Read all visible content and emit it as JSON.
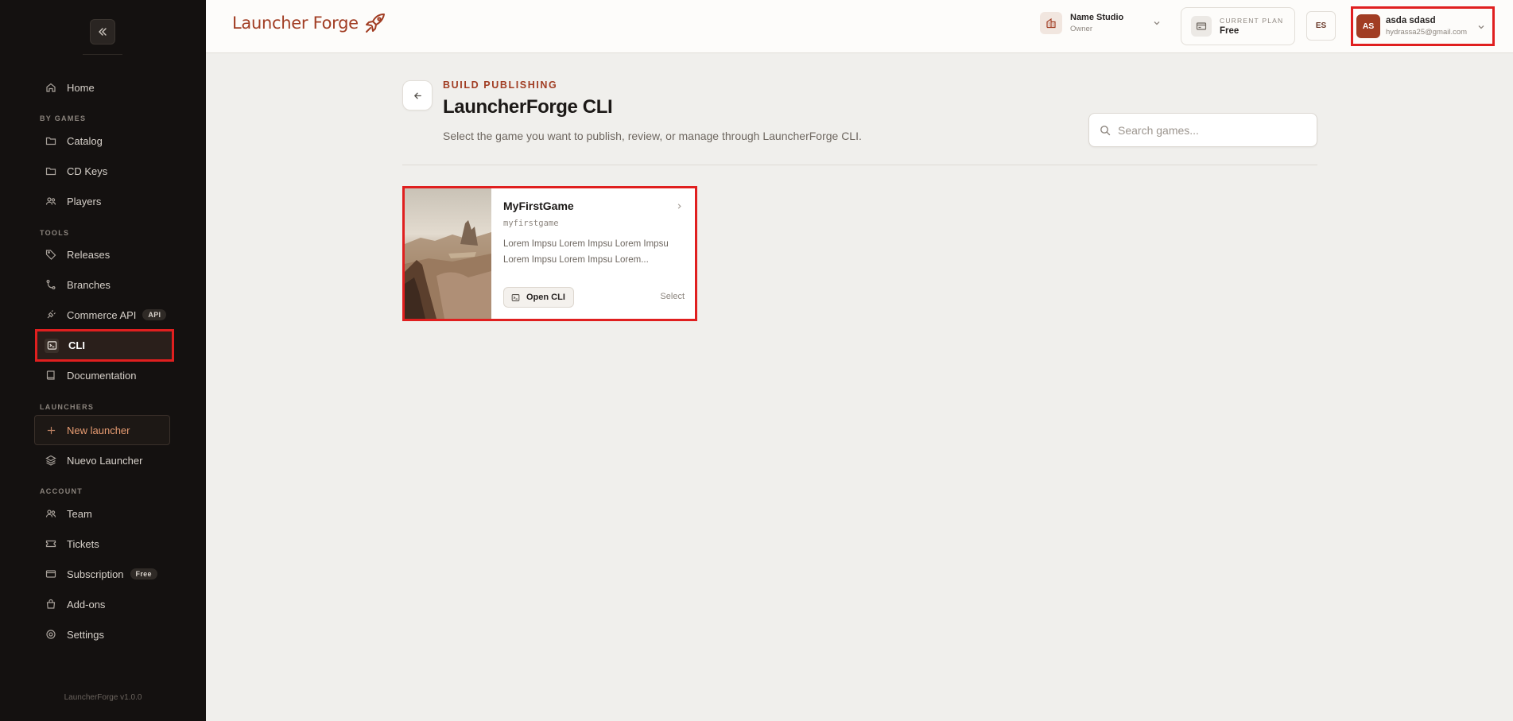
{
  "brand": {
    "name": "Launcher Forge",
    "version": "LauncherForge v1.0.0"
  },
  "sidebar": {
    "sections": {
      "games": "BY GAMES",
      "tools": "TOOLS",
      "launchers": "LAUNCHERS",
      "account": "ACCOUNT"
    },
    "items": {
      "home": "Home",
      "catalog": "Catalog",
      "cdkeys": "CD Keys",
      "players": "Players",
      "releases": "Releases",
      "branches": "Branches",
      "commerce": "Commerce API",
      "commerce_badge": "API",
      "cli": "CLI",
      "documentation": "Documentation",
      "new_launcher": "New launcher",
      "nuevo_launcher": "Nuevo Launcher",
      "team": "Team",
      "tickets": "Tickets",
      "subscription": "Subscription",
      "subscription_badge": "Free",
      "addons": "Add-ons",
      "settings": "Settings"
    }
  },
  "header": {
    "studio": {
      "name": "Name Studio",
      "role": "Owner"
    },
    "plan": {
      "label": "CURRENT PLAN",
      "value": "Free"
    },
    "language": "ES",
    "user": {
      "initials": "AS",
      "name": "asda sdasd",
      "email": "hydrassa25@gmail.com"
    }
  },
  "page": {
    "eyebrow": "BUILD PUBLISHING",
    "title": "LauncherForge CLI",
    "subtitle": "Select the game you want to publish, review, or manage through LauncherForge CLI.",
    "search_placeholder": "Search games..."
  },
  "games": [
    {
      "name": "MyFirstGame",
      "slug": "myfirstgame",
      "description": "Lorem Impsu Lorem Impsu Lorem Impsu Lorem Impsu Lorem Impsu Lorem...",
      "open_label": "Open CLI",
      "select_label": "Select"
    }
  ],
  "colors": {
    "accent": "#a13d23",
    "sidebar_bg": "#141110",
    "highlight": "#e01f1f"
  }
}
